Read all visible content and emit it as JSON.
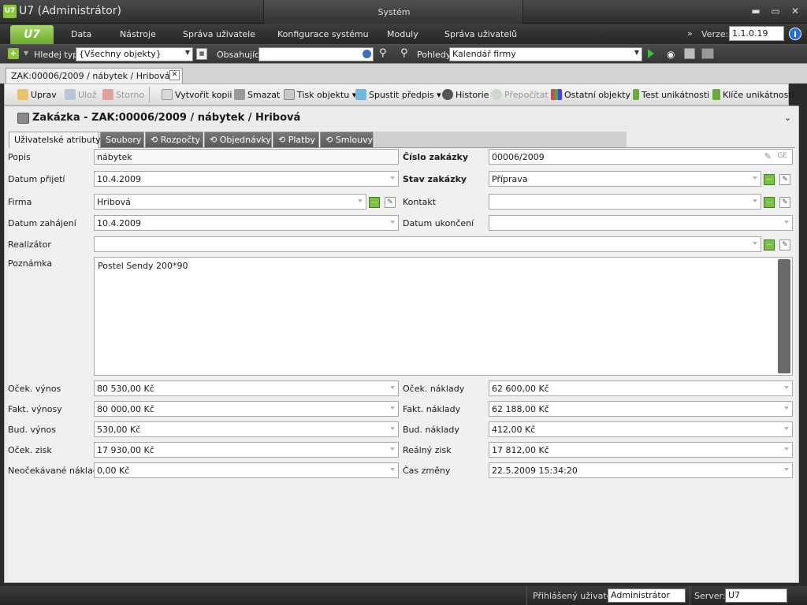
{
  "window": {
    "title": "U7 (Administrátor)",
    "logo_text": "U7",
    "center_panel": "Systém",
    "min": "▬",
    "max": "▭",
    "close": "✕"
  },
  "menu": {
    "logo": "U7",
    "items": [
      "Data",
      "Nástroje",
      "Správa uživatele",
      "Konfigurace systému",
      "Moduly",
      "Správa uživatelů"
    ],
    "version_label": "Verze:",
    "version_value": "1.1.0.19",
    "chevron": "»",
    "info": "i"
  },
  "search": {
    "find_type_label": "Hledej typ",
    "find_type_value": "{Všechny objekty}",
    "containing_label": "Obsahující",
    "containing_value": "",
    "views_label": "Pohledy",
    "views_value": "Kalendář firmy"
  },
  "doc_tab": {
    "label": "ZAK:00006/2009 / nábytek / Hribová",
    "close": "✕"
  },
  "toolbar": {
    "edit": "Uprav",
    "save": "Ulož",
    "cancel": "Storno",
    "copy": "Vytvořit kopii",
    "delete": "Smazat",
    "print": "Tisk objektu",
    "run": "Spustit předpis",
    "history": "Historie",
    "recalc": "Přepočítat",
    "other": "Ostatní objekty",
    "uniq_test": "Test unikátnosti",
    "uniq_keys": "Klíče unikátnosti"
  },
  "object_title": "Zakázka - ZAK:00006/2009 / nábytek / Hribová",
  "tabs": [
    "Uživatelské atributy",
    "Soubory",
    "Rozpočty",
    "Objednávky",
    "Platby",
    "Smlouvy"
  ],
  "form": {
    "popis_label": "Popis",
    "popis_value": "nábytek",
    "cislo_label": "Číslo zakázky",
    "cislo_value": "00006/2009",
    "cislo_ge": "GE",
    "datum_prijeti_label": "Datum přijetí",
    "datum_prijeti_value": "10.4.2009",
    "stav_label": "Stav zakázky",
    "stav_value": "Příprava",
    "firma_label": "Firma",
    "firma_value": "Hribová",
    "kontakt_label": "Kontakt",
    "kontakt_value": "",
    "datum_zahajeni_label": "Datum zahájení",
    "datum_zahajeni_value": "10.4.2009",
    "datum_ukonceni_label": "Datum ukončení",
    "datum_ukonceni_value": "",
    "realizator_label": "Realizátor",
    "realizator_value": "",
    "poznamka_label": "Poznámka",
    "poznamka_value": "Postel Sendy 200*90",
    "ocek_vynos_label": "Oček. výnos",
    "ocek_vynos_value": "80 530,00 Kč",
    "ocek_naklady_label": "Oček. náklady",
    "ocek_naklady_value": "62 600,00 Kč",
    "fakt_vynosy_label": "Fakt. výnosy",
    "fakt_vynosy_value": "80 000,00 Kč",
    "fakt_naklady_label": "Fakt. náklady",
    "fakt_naklady_value": "62 188,00 Kč",
    "bud_vynos_label": "Bud. výnos",
    "bud_vynos_value": "530,00 Kč",
    "bud_naklady_label": "Bud. náklady",
    "bud_naklady_value": "412,00 Kč",
    "ocek_zisk_label": "Oček. zisk",
    "ocek_zisk_value": "17 930,00 Kč",
    "realny_zisk_label": "Reálný zisk",
    "realny_zisk_value": "17 812,00 Kč",
    "neocek_label": "Neočekávané náklady",
    "neocek_value": "0,00 Kč",
    "cas_zmeny_label": "Čas změny",
    "cas_zmeny_value": "22.5.2009 15:34:20"
  },
  "status": {
    "user_label": "Přihlášený uživatel:",
    "user_value": "Administrátor",
    "server_label": "Server:",
    "server_value": "U7"
  }
}
